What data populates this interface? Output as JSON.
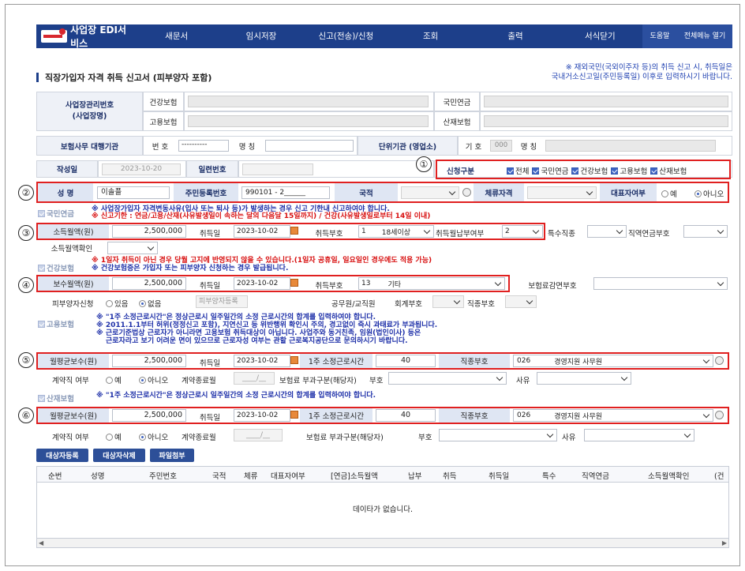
{
  "nav": {
    "brand": "사업장 EDI서비스",
    "items": [
      "새문서",
      "임시저장",
      "신고(전송)/신청",
      "조회",
      "출력",
      "서식닫기"
    ],
    "help": "도움말",
    "all_menu": "전체메뉴 열기"
  },
  "page": {
    "title": "직장가입자 자격 취득 신고서 (피부양자 포함)",
    "note1": "※ 재외국민(국외이주자 등)의 취득 신고 시, 취득일은",
    "note2": "국내거소신고일(주민등록일) 이후로 입력하시기 바랍니다."
  },
  "biz": {
    "label1": "사업장관리번호",
    "label2": "(사업장명)",
    "health": "건강보험",
    "pension": "국민연금",
    "employ": "고용보험",
    "accident": "산재보험",
    "agency_label": "보험사무 대행기관",
    "num_label": "번 호",
    "num_value": "----------",
    "name_label": "명 칭",
    "unit_label": "단위기관 (영업소)",
    "code_label": "기 호",
    "code_value": "000",
    "unit_name_label": "명 칭"
  },
  "meta": {
    "date_label": "작성일",
    "date_value": "2023-10-20",
    "serial_label": "일련번호",
    "apply_label": "신청구분",
    "apply_items": [
      "전체",
      "국민연금",
      "건강보험",
      "고용보험",
      "산재보험"
    ]
  },
  "person": {
    "name_label": "성 명",
    "name_value": "이솔플",
    "rrn_label": "주민등록번호",
    "rrn_value": "990101 - 2______",
    "nation_label": "국적",
    "stay_label": "체류자격",
    "rep_label": "대표자여부",
    "rep_yes": "예",
    "rep_no": "아니오"
  },
  "pension": {
    "section": "국민연금",
    "warn1": "※ 사업장가입자 자격변동사유(입사 또는 퇴사 등)가 발생하는 경우 신고 기한내 신고하여야 합니다.",
    "warn2": "※ 신고기한 : 연금/고용/산재(사유발생일이 속하는 달의 다음달 15일까지) / 건강(사유발생일로부터 14일 이내)",
    "income_label": "소득월액(원)",
    "income_value": "2,500,000",
    "acq_date_label": "취득일",
    "acq_date_value": "2023-10-02",
    "acq_code_label": "취득부호",
    "acq_code_value": "1",
    "acq_code_text": "18세이상",
    "pay_label": "취득월납부여부",
    "pay_value": "2",
    "special_label": "특수직종",
    "job_label": "직역연금부호",
    "confirm_label": "소득월액확인"
  },
  "health": {
    "section": "건강보험",
    "warn1": "※ 1일자 취득이 아닌 경우 당월 고지에 반영되지 않을 수 있습니다.(1일자 공휴일, 일요일인 경우에도 적용 가능)",
    "warn2": "※ 건강보험증은 가입자 또는 피부양자 신청하는 경우 발급됩니다.",
    "pay_label": "보수월액(원)",
    "pay_value": "2,500,000",
    "acq_date_label": "취득일",
    "acq_date_value": "2023-10-02",
    "acq_code_label": "취득부호",
    "acq_code_value": "13",
    "acq_code_text": "기타",
    "reduce_label": "보험료감면부호",
    "dep_label": "피부양자신청",
    "dep_yes": "있음",
    "dep_no": "없음",
    "dep_btn": "피부양자등록",
    "civil_label": "공무원/교직원",
    "account_label": "회계부호",
    "job_label": "직종부호"
  },
  "employ": {
    "section": "고용보험",
    "warn1": "※ \"1주 소정근로시간\"은 정상근로시 일주일간의  소정 근로시간의 합계를 입력하여야 합니다.",
    "warn2": "※ 2011.1.1부터 허위(정정신고 포함), 지연신고 등 위반행위 확인시 주의, 경고없이 즉시 과태료가 부과됩니다.",
    "warn3": "※ 근로기준법상 근로자가 아니라면 고용보험 취득대상이 아닙니다. 사업주와 동거친족, 임원(법인이사) 등은",
    "warn4": "근로자라고 보기 어려운 면이 있으므로 근로자성 여부는 관할 근로복지공단으로 문의하시기 바랍니다.",
    "avg_label": "월평균보수(원)",
    "avg_value": "2,500,000",
    "acq_date_label": "취득일",
    "acq_date_value": "2023-10-02",
    "hours_label": "1주 소정근로시간",
    "hours_value": "40",
    "job_label": "직종부호",
    "job_code": "026",
    "job_text": "경영지원 사무원",
    "contract_label": "계약직 여부",
    "yes": "예",
    "no": "아니오",
    "end_label": "계약종료월",
    "end_value": "____/__",
    "charge_label": "보험료 부과구분(해당자)",
    "code_label": "부호",
    "reason_label": "사유"
  },
  "accident": {
    "section": "산재보험",
    "warn1": "※ \"1주 소정근로시간\"은 정상근로시 일주일간의  소정 근로시간의 합계를 입력하여야 합니다.",
    "avg_label": "월평균보수(원)",
    "avg_value": "2,500,000",
    "acq_date_label": "취득일",
    "acq_date_value": "2023-10-02",
    "hours_label": "1주 소정근로시간",
    "hours_value": "40",
    "job_label": "직종부호",
    "job_code": "026",
    "job_text": "경영지원 사무원",
    "contract_label": "계약직 여부",
    "yes": "예",
    "no": "아니오",
    "end_label": "계약종료월",
    "end_value": "____/__",
    "charge_label": "보험료 부과구분(해당자)",
    "code_label": "부호",
    "reason_label": "사유"
  },
  "buttons": {
    "register": "대상자등록",
    "delete": "대상자삭제",
    "attach": "파일첨부"
  },
  "grid": {
    "columns": [
      "순번",
      "성명",
      "주민번호",
      "국적",
      "체류",
      "대표자여부",
      "[연금]소득월액",
      "납부",
      "취득",
      "취득일",
      "특수",
      "직역연금",
      "소득월액확인",
      "(건"
    ],
    "empty": "데이타가 없습니다."
  },
  "markers": [
    "①",
    "②",
    "③",
    "④",
    "⑤",
    "⑥"
  ]
}
